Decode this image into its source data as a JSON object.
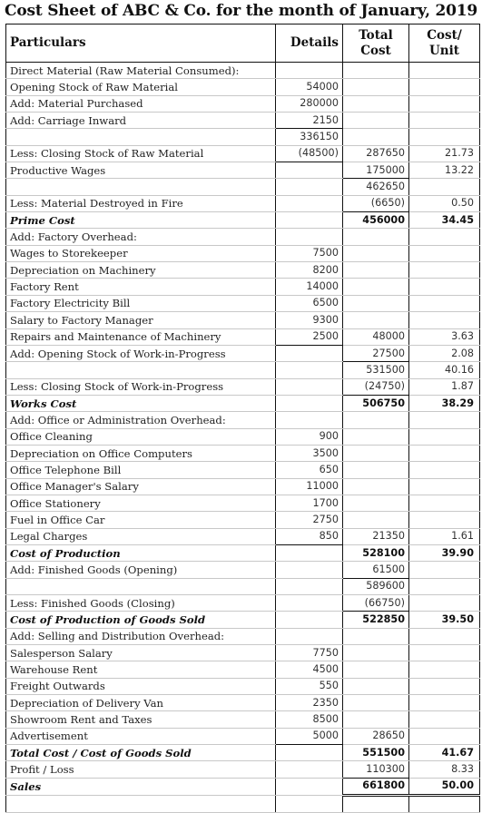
{
  "title": "Cost Sheet of ABC & Co. for the month of January, 2019",
  "headers": {
    "particulars": "Particulars",
    "details": "Details",
    "total_line1": "Total",
    "total_line2": "Cost",
    "unit_line1": "Cost/",
    "unit_line2": "Unit"
  },
  "rows": [
    {
      "particulars": "Direct Material (Raw Material Consumed):",
      "details": "",
      "total": "",
      "unit": ""
    },
    {
      "particulars": "Opening Stock of Raw Material",
      "details": "54000",
      "total": "",
      "unit": ""
    },
    {
      "particulars": "Add: Material Purchased",
      "details": "280000",
      "total": "",
      "unit": ""
    },
    {
      "particulars": "Add: Carriage Inward",
      "details": "2150",
      "total": "",
      "unit": ""
    },
    {
      "particulars": "",
      "details": "336150",
      "total": "",
      "unit": ""
    },
    {
      "particulars": "Less: Closing Stock of Raw Material",
      "details": "(48500)",
      "total": "287650",
      "unit": "21.73"
    },
    {
      "particulars": "Productive Wages",
      "details": "",
      "total": "175000",
      "unit": "13.22"
    },
    {
      "particulars": "",
      "details": "",
      "total": "462650",
      "unit": ""
    },
    {
      "particulars": "Less: Material Destroyed in Fire",
      "details": "",
      "total": "(6650)",
      "unit": "0.50"
    },
    {
      "particulars": "Prime Cost",
      "details": "",
      "total": "456000",
      "unit": "34.45"
    },
    {
      "particulars": "Add: Factory Overhead:",
      "details": "",
      "total": "",
      "unit": ""
    },
    {
      "particulars": "Wages to Storekeeper",
      "details": "7500",
      "total": "",
      "unit": ""
    },
    {
      "particulars": "Depreciation on Machinery",
      "details": "8200",
      "total": "",
      "unit": ""
    },
    {
      "particulars": "Factory Rent",
      "details": "14000",
      "total": "",
      "unit": ""
    },
    {
      "particulars": "Factory Electricity Bill",
      "details": "6500",
      "total": "",
      "unit": ""
    },
    {
      "particulars": "Salary to Factory Manager",
      "details": "9300",
      "total": "",
      "unit": ""
    },
    {
      "particulars": "Repairs and Maintenance of Machinery",
      "details": "2500",
      "total": "48000",
      "unit": "3.63"
    },
    {
      "particulars": "Add: Opening Stock of Work-in-Progress",
      "details": "",
      "total": "27500",
      "unit": "2.08"
    },
    {
      "particulars": "",
      "details": "",
      "total": "531500",
      "unit": "40.16"
    },
    {
      "particulars": "Less: Closing Stock of Work-in-Progress",
      "details": "",
      "total": "(24750)",
      "unit": "1.87"
    },
    {
      "particulars": "Works Cost",
      "details": "",
      "total": "506750",
      "unit": "38.29"
    },
    {
      "particulars": "Add: Office or Administration Overhead:",
      "details": "",
      "total": "",
      "unit": ""
    },
    {
      "particulars": "Office Cleaning",
      "details": "900",
      "total": "",
      "unit": ""
    },
    {
      "particulars": "Depreciation on Office Computers",
      "details": "3500",
      "total": "",
      "unit": ""
    },
    {
      "particulars": "Office Telephone Bill",
      "details": "650",
      "total": "",
      "unit": ""
    },
    {
      "particulars": "Office Manager's Salary",
      "details": "11000",
      "total": "",
      "unit": ""
    },
    {
      "particulars": "Office Stationery",
      "details": "1700",
      "total": "",
      "unit": ""
    },
    {
      "particulars": "Fuel in Office Car",
      "details": "2750",
      "total": "",
      "unit": ""
    },
    {
      "particulars": "Legal Charges",
      "details": "850",
      "total": "21350",
      "unit": "1.61"
    },
    {
      "particulars": "Cost of Production",
      "details": "",
      "total": "528100",
      "unit": "39.90"
    },
    {
      "particulars": "Add: Finished Goods (Opening)",
      "details": "",
      "total": "61500",
      "unit": ""
    },
    {
      "particulars": "",
      "details": "",
      "total": "589600",
      "unit": ""
    },
    {
      "particulars": "Less: Finished Goods (Closing)",
      "details": "",
      "total": "(66750)",
      "unit": ""
    },
    {
      "particulars": "Cost of Production of Goods Sold",
      "details": "",
      "total": "522850",
      "unit": "39.50"
    },
    {
      "particulars": "Add: Selling and Distribution Overhead:",
      "details": "",
      "total": "",
      "unit": ""
    },
    {
      "particulars": "Salesperson Salary",
      "details": "7750",
      "total": "",
      "unit": ""
    },
    {
      "particulars": "Warehouse Rent",
      "details": "4500",
      "total": "",
      "unit": ""
    },
    {
      "particulars": "Freight Outwards",
      "details": "550",
      "total": "",
      "unit": ""
    },
    {
      "particulars": "Depreciation of Delivery Van",
      "details": "2350",
      "total": "",
      "unit": ""
    },
    {
      "particulars": "Showroom Rent and Taxes",
      "details": "8500",
      "total": "",
      "unit": ""
    },
    {
      "particulars": "Advertisement",
      "details": "5000",
      "total": "28650",
      "unit": ""
    },
    {
      "particulars": "Total Cost / Cost of Goods Sold",
      "details": "",
      "total": "551500",
      "unit": "41.67"
    },
    {
      "particulars": "Profit / Loss",
      "details": "",
      "total": "110300",
      "unit": "8.33"
    },
    {
      "particulars": "Sales",
      "details": "",
      "total": "661800",
      "unit": "50.00"
    },
    {
      "particulars": "",
      "details": "",
      "total": "",
      "unit": ""
    }
  ]
}
